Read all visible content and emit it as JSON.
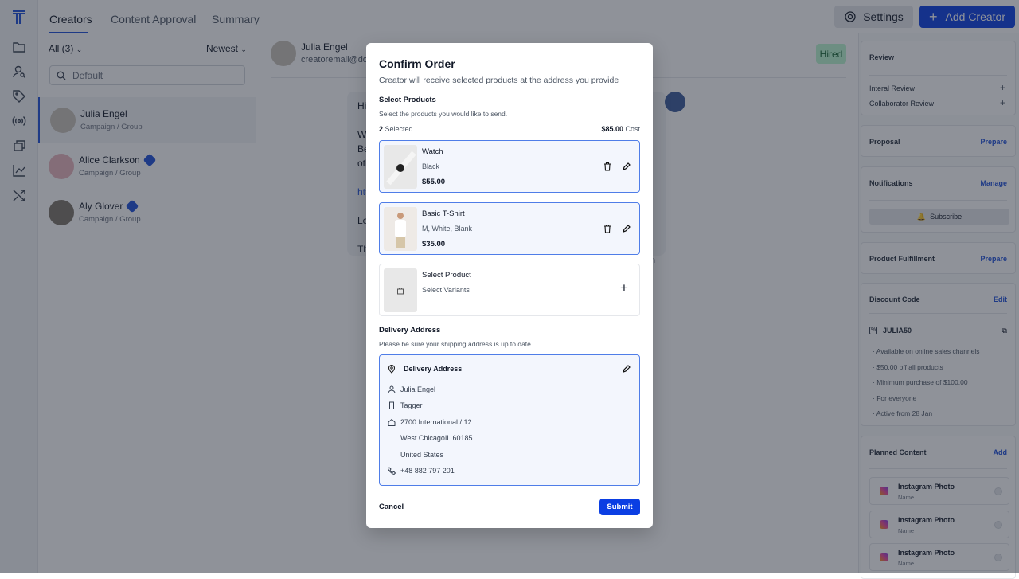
{
  "nav": {
    "tabs": [
      "Creators",
      "Content Approval",
      "Summary"
    ],
    "active_tab": "Creators",
    "rail_icons": [
      "logo-icon",
      "folder-icon",
      "user-search-icon",
      "tag-icon",
      "broadcast-icon",
      "copy-icon",
      "chart-line-icon",
      "shuffle-icon"
    ]
  },
  "header": {
    "settings_label": "Settings",
    "add_creator_label": "Add Creator",
    "accent": "#0b3ee3"
  },
  "list": {
    "filter": "All (3)",
    "sort": "Newest",
    "search_placeholder": "Default",
    "creators": [
      {
        "name": "Julia Engel",
        "sub": "Campaign / Group",
        "verified": false,
        "selected": true
      },
      {
        "name": "Alice Clarkson",
        "sub": "Campaign / Group",
        "verified": true
      },
      {
        "name": "Aly Glover",
        "sub": "Campaign / Group",
        "verified": true
      }
    ]
  },
  "chat": {
    "name": "Julia Engel",
    "email": "creatoremail@do",
    "status": "Hired",
    "message_fragments": [
      "Hi",
      "We",
      "Be",
      "oth",
      "htt",
      "Le",
      "Th"
    ],
    "timestamp_fragment": "en"
  },
  "right": {
    "review": {
      "title": "Review",
      "items": [
        "Interal Review",
        "Collaborator Review"
      ]
    },
    "proposal": {
      "title": "Proposal",
      "action": "Prepare"
    },
    "notifications": {
      "title": "Notifications",
      "action": "Manage",
      "button": "Subscribe"
    },
    "fulfillment": {
      "title": "Product Fulfillment",
      "action": "Prepare"
    },
    "discount": {
      "title": "Discount Code",
      "action": "Edit",
      "code": "JULIA50",
      "bullets": [
        "Available on online sales channels",
        "$50.00 off all products",
        "Minimum purchase of $100.00",
        "For everyone",
        "Active from 28 Jan"
      ]
    },
    "planned": {
      "title": "Planned Content",
      "action": "Add",
      "items": [
        {
          "title": "Instagram Photo",
          "sub": "Name"
        },
        {
          "title": "Instagram Photo",
          "sub": "Name"
        },
        {
          "title": "Instagram Photo",
          "sub": "Name"
        }
      ]
    }
  },
  "modal": {
    "title": "Confirm Order",
    "subtitle": "Creator will receive selected products at the address you provide",
    "products_title": "Select Products",
    "products_sub": "Select the products you would like to send.",
    "selected_count": "2",
    "selected_label": "Selected",
    "cost": "$85.00",
    "cost_label": "Cost",
    "products": [
      {
        "name": "Watch",
        "variant": "Black",
        "price": "$55.00"
      },
      {
        "name": "Basic T-Shirt",
        "variant": "M, White, Blank",
        "price": "$35.00"
      }
    ],
    "empty_product": {
      "name": "Select Product",
      "variant": "Select Variants"
    },
    "address_title": "Delivery Address",
    "address_sub": "Please be sure your shipping address is up to date",
    "address": {
      "header": "Delivery Address",
      "name": "Julia Engel",
      "company": "Tagger",
      "street": "2700 International / 12",
      "city": "West ChicagoIL 60185",
      "country": "United States",
      "phone": "+48 882 797 201"
    },
    "cancel": "Cancel",
    "submit": "Submit"
  }
}
